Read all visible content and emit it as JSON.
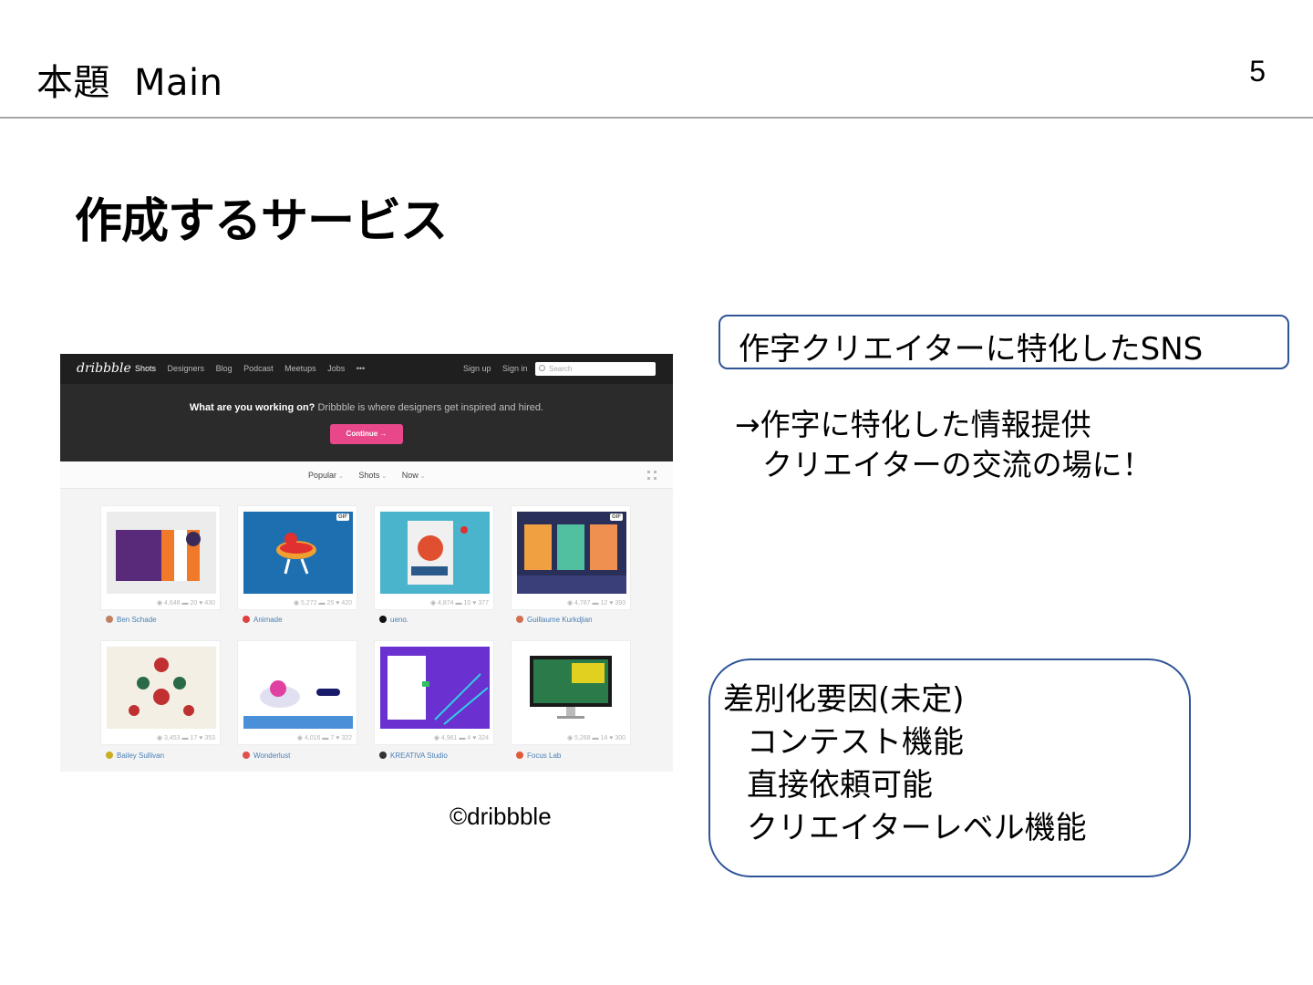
{
  "header": {
    "title_ja": "本題",
    "title_en": "Main",
    "page_number": "5"
  },
  "section_title": "作成するサービス",
  "dribbble_screenshot": {
    "logo": "dribbble",
    "nav": [
      "Shots",
      "Designers",
      "Blog",
      "Podcast",
      "Meetups",
      "Jobs",
      "•••"
    ],
    "nav_right": [
      "Sign up",
      "Sign in"
    ],
    "search_placeholder": "Search",
    "hero_bold": "What are you working on?",
    "hero_rest": " Dribbble is where designers get inspired and hired.",
    "continue_label": "Continue →",
    "filters": [
      "Popular",
      "Shots",
      "Now"
    ],
    "shots": [
      {
        "author": "Ben Schade",
        "views": "4,648",
        "comments": "20",
        "likes": "430",
        "avatar": "#c08060"
      },
      {
        "author": "Animade",
        "views": "5,272",
        "comments": "25",
        "likes": "420",
        "avatar": "#e04040",
        "gif": "GIF"
      },
      {
        "author": "ueno.",
        "views": "4,874",
        "comments": "10",
        "likes": "377",
        "avatar": "#111111"
      },
      {
        "author": "Guillaume Kurkdjian",
        "views": "4,787",
        "comments": "12",
        "likes": "393",
        "avatar": "#d07050",
        "gif": "GIF"
      },
      {
        "author": "Bailey Sullivan",
        "views": "3,453",
        "comments": "17",
        "likes": "353",
        "avatar": "#c8b020"
      },
      {
        "author": "Wonderlust",
        "views": "4,016",
        "comments": "7",
        "likes": "322",
        "avatar": "#e05050"
      },
      {
        "author": "KREATIVA Studio",
        "views": "4,961",
        "comments": "4",
        "likes": "324",
        "avatar": "#333333"
      },
      {
        "author": "Focus Lab",
        "views": "5,268",
        "comments": "14",
        "likes": "300",
        "avatar": "#e05a3a"
      }
    ]
  },
  "credit": "©dribbble",
  "sns_box": "作字クリエイターに特化したSNS",
  "description": [
    "→作字に特化した情報提供",
    "クリエイターの交流の場に！"
  ],
  "differentiation": {
    "heading": "差別化要因(未定)",
    "items": [
      "コンテスト機能",
      "直接依頼可能",
      "クリエイターレベル機能"
    ]
  }
}
